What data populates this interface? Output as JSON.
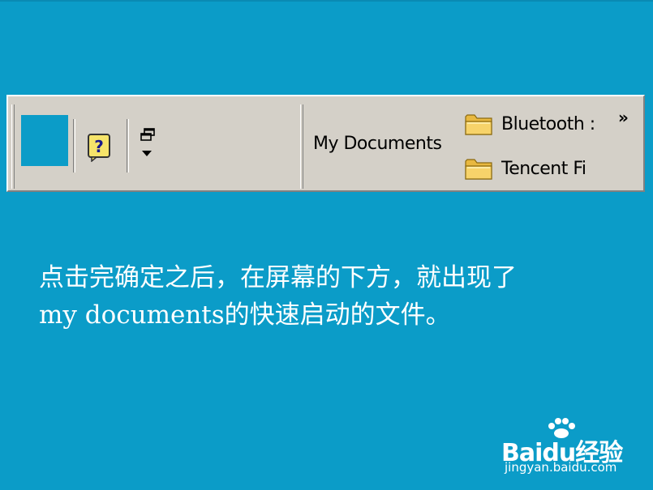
{
  "taskbar": {
    "toolbar_label": "My Documents",
    "chevron": "»",
    "folders": [
      {
        "label": "Bluetooth :",
        "icon": "folder-icon"
      },
      {
        "label": "Tencent Fi",
        "icon": "folder-icon"
      }
    ],
    "icons": [
      "help-icon",
      "restore-window-icon"
    ]
  },
  "caption": {
    "line1": "点击完确定之后，在屏幕的下方，就出现了",
    "line2": "my documents的快速启动的文件。"
  },
  "watermark": {
    "logo": "Baidu经验",
    "url": "jingyan.baidu.com"
  },
  "colors": {
    "background": "#0b9cc8",
    "taskbar": "#d4d0c8",
    "text_on_background": "#ffffff"
  }
}
